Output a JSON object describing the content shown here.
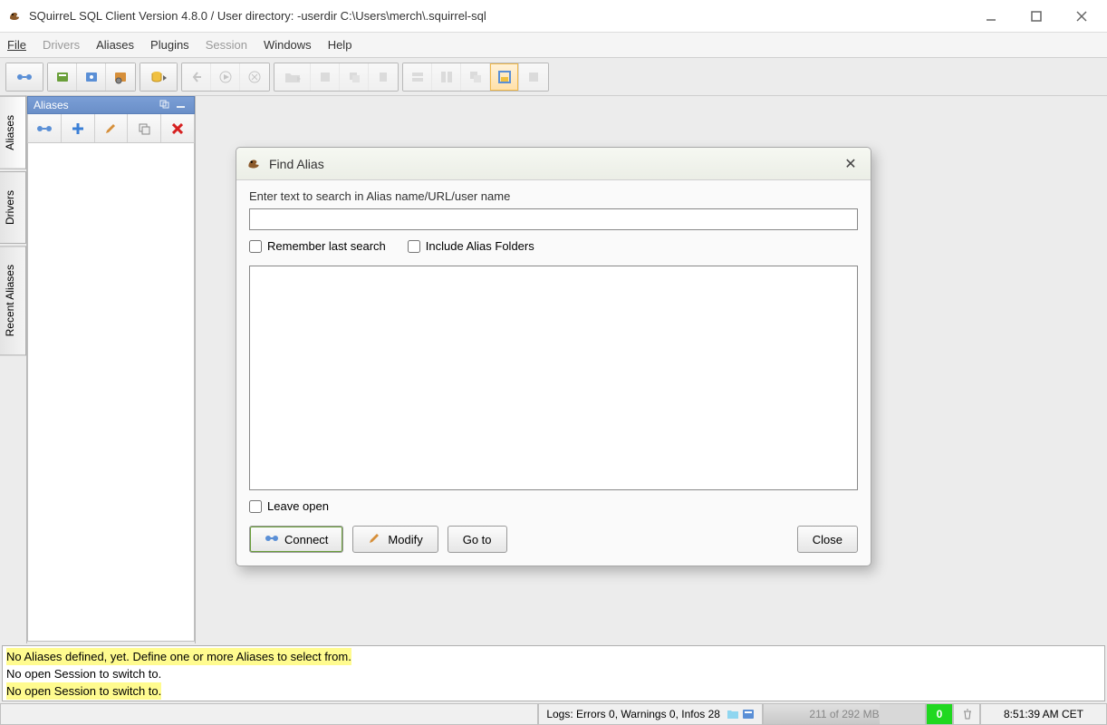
{
  "window": {
    "title": "SQuirreL SQL Client Version 4.8.0 / User directory: -userdir C:\\Users\\merch\\.squirrel-sql"
  },
  "menu": {
    "file": "File",
    "drivers": "Drivers",
    "aliases": "Aliases",
    "plugins": "Plugins",
    "session": "Session",
    "windows": "Windows",
    "help": "Help"
  },
  "sidebar": {
    "tabs": {
      "aliases": "Aliases",
      "drivers": "Drivers",
      "recent": "Recent Aliases"
    },
    "panel_title": "Aliases"
  },
  "dialog": {
    "title": "Find Alias",
    "prompt": "Enter text to search in Alias name/URL/user name",
    "remember": "Remember last search",
    "include_folders": "Include Alias Folders",
    "leave_open": "Leave open",
    "connect": "Connect",
    "modify": "Modify",
    "goto": "Go to",
    "close": "Close",
    "search_value": ""
  },
  "log": {
    "line1": "No Aliases defined, yet. Define one or more Aliases to select from.",
    "line2": "No open Session to switch to.",
    "line3": "No open Session to switch to."
  },
  "status": {
    "logs": "Logs: Errors 0, Warnings 0, Infos 28",
    "mem": "211 of 292 MB",
    "count": "0",
    "time": "8:51:39 AM CET"
  }
}
